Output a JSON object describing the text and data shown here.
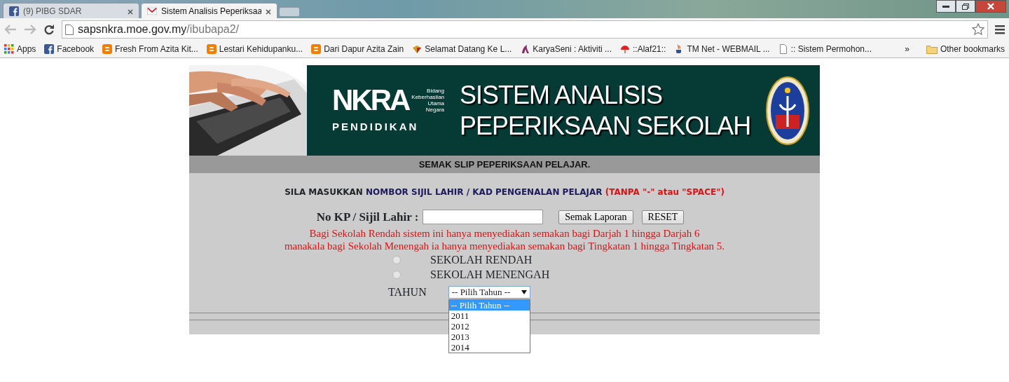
{
  "browser": {
    "tabs": [
      {
        "kind": "facebook",
        "title": "(9) PIBG SDAR",
        "selected": false
      },
      {
        "kind": "mail",
        "title": "Sistem Analisis Peperiksaa",
        "selected": true
      }
    ],
    "address": {
      "host": "sapsnkra.moe.gov.my",
      "path": "/ibubapa2/"
    },
    "bookmarks": [
      {
        "kind": "apps",
        "label": "Apps"
      },
      {
        "kind": "facebook",
        "label": "Facebook"
      },
      {
        "kind": "blog",
        "label": "Fresh From Azita Kit..."
      },
      {
        "kind": "blog",
        "label": "Lestari Kehidupanku..."
      },
      {
        "kind": "blog",
        "label": "Dari Dapur Azita Zain"
      },
      {
        "kind": "leaf",
        "label": "Selamat Datang Ke L..."
      },
      {
        "kind": "figure",
        "label": "KaryaSeni : Aktiviti ..."
      },
      {
        "kind": "umbrella",
        "label": "::Alaf21::"
      },
      {
        "kind": "cup",
        "label": "TM Net - WEBMAIL ..."
      },
      {
        "kind": "page",
        "label": ":: Sistem Permohon..."
      }
    ],
    "more": "»",
    "other_bookmarks": "Other bookmarks"
  },
  "banner": {
    "nkra": "NKRA",
    "nkra_words": [
      "Bidang",
      "Keberhasilan",
      "Utama",
      "Negara"
    ],
    "subtitle": "PENDIDIKAN",
    "title_lines": [
      "SISTEM ANALISIS",
      "PEPERIKSAAN SEKOLAH"
    ]
  },
  "section_title": "SEMAK SLIP PEPERIKSAAN PELAJAR.",
  "instruction": [
    {
      "kind": "plain",
      "text": "SILA MASUKKAN "
    },
    {
      "kind": "emphasis",
      "text": "NOMBOR SIJIL LAHIR / KAD PENGENALAN PELAJAR"
    },
    {
      "kind": "warning",
      "text": " (TANPA \"-\" atau \"SPACE\")"
    }
  ],
  "form": {
    "label": "No KP / Sijil Lahir :",
    "buttons": [
      "Semak Laporan",
      "RESET"
    ],
    "notes": [
      "Bagi Sekolah Rendah sistem ini hanya menyediakan semakan bagi Darjah 1 hingga Darjah 6",
      "manakala bagi Sekolah Menengah ia hanya menyediakan semakan bagi Tingkatan 1 hingga Tingkatan 5."
    ],
    "school_types": [
      {
        "label": "SEKOLAH RENDAH",
        "selected": false
      },
      {
        "label": "SEKOLAH MENENGAH",
        "selected": false
      }
    ],
    "year": {
      "label": "TAHUN",
      "value": "-- Pilih Tahun --",
      "expanded": true,
      "options": [
        {
          "label": "-- Pilih Tahun --",
          "selected": true
        },
        {
          "label": "2011",
          "selected": false
        },
        {
          "label": "2012",
          "selected": false
        },
        {
          "label": "2013",
          "selected": false
        },
        {
          "label": "2014",
          "selected": false
        }
      ]
    }
  }
}
